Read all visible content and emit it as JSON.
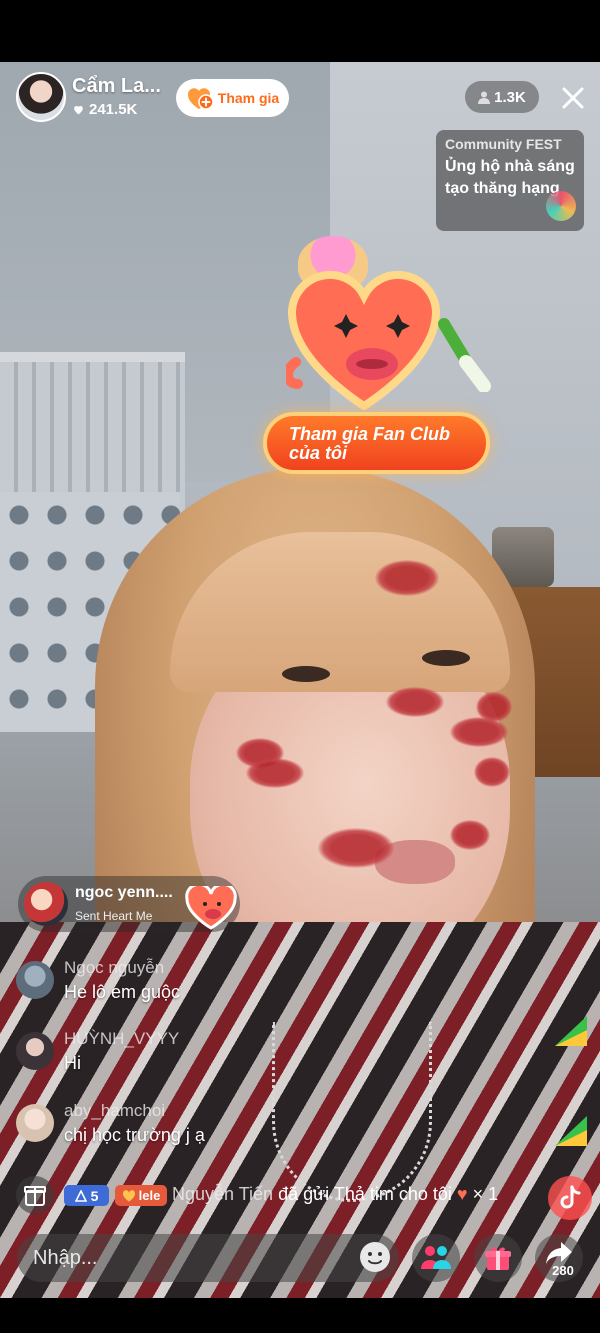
{
  "host": {
    "name": "Cẩm La...",
    "likes": "241.5K",
    "join_label": "Tham gia"
  },
  "viewers": {
    "count": "1.3K"
  },
  "community": {
    "title": "Community FEST",
    "text": "Ủng hộ nhà sáng tạo thăng hạng"
  },
  "fan_club": {
    "label": "Tham gia Fan Club của tôi"
  },
  "gift_event": {
    "user": "ngoc yenn....",
    "action": "Sent Heart Me"
  },
  "comments": [
    {
      "user": "Ngọc nguyễn",
      "text": "He lô em guộc",
      "avatar_color": "#5e6d7c"
    },
    {
      "user": "HUỲNH_VYYY",
      "text": "Hi",
      "avatar_color": "#3b3338"
    },
    {
      "user": "aby_hamchoi",
      "text": "chị học trường j ạ",
      "avatar_color": "#d8c3b1"
    }
  ],
  "activity": {
    "level": "5",
    "fan_tag": "lele",
    "user": "Nguyễn Tiến",
    "message": "đã gửi Thả tim cho tôi",
    "multiplier": "× 1"
  },
  "input": {
    "placeholder": "Nhập..."
  },
  "share": {
    "count": "280"
  },
  "colors": {
    "accent_orange": "#ff6a1a",
    "level_blue": "#3f6bd6",
    "fan_red": "#e45a3a"
  },
  "icons": [
    "heart-icon",
    "person-icon",
    "close-icon",
    "gift-box-icon",
    "emoji-icon",
    "multi-guest-icon",
    "gift-icon",
    "share-icon",
    "tiktok-icon"
  ]
}
